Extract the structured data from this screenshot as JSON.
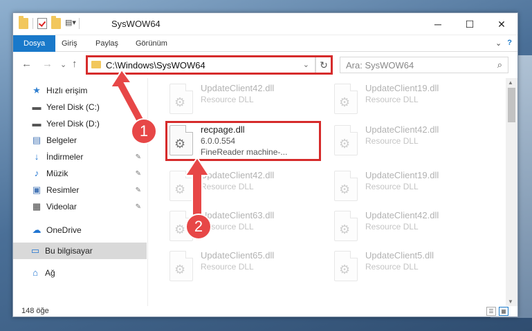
{
  "window": {
    "title": "SysWOW64",
    "minimize": "─",
    "maximize": "☐",
    "close": "✕"
  },
  "ribbon": {
    "tabs": [
      "Dosya",
      "Giriş",
      "Paylaş",
      "Görünüm"
    ],
    "expand": "⌄",
    "help": "?"
  },
  "nav": {
    "back": "←",
    "forward": "→",
    "recent": "⌄",
    "up": "↑",
    "address": "C:\\Windows\\SysWOW64",
    "address_dropdown": "⌄",
    "refresh": "↻",
    "search_placeholder": "Ara: SysWOW64",
    "search_icon": "⌕"
  },
  "sidebar": {
    "items": [
      {
        "label": "Hızlı erişim",
        "icon": "star-icon",
        "glyph": "★"
      },
      {
        "label": "Yerel Disk (C:)",
        "icon": "drive-icon",
        "glyph": "▬"
      },
      {
        "label": "Yerel Disk (D:)",
        "icon": "drive-icon",
        "glyph": "▬"
      },
      {
        "label": "Belgeler",
        "icon": "documents-icon",
        "glyph": "▤"
      },
      {
        "label": "İndirmeler",
        "icon": "download-icon",
        "glyph": "↓"
      },
      {
        "label": "Müzik",
        "icon": "music-icon",
        "glyph": "♪"
      },
      {
        "label": "Resimler",
        "icon": "pictures-icon",
        "glyph": "▣"
      },
      {
        "label": "Videolar",
        "icon": "videos-icon",
        "glyph": "▦"
      },
      {
        "label": "OneDrive",
        "icon": "cloud-icon",
        "glyph": "☁"
      },
      {
        "label": "Bu bilgisayar",
        "icon": "computer-icon",
        "glyph": "▭"
      },
      {
        "label": "Ağ",
        "icon": "network-icon",
        "glyph": "⌂"
      }
    ],
    "pin_glyph": "✎"
  },
  "files": {
    "left": [
      {
        "name": "UpdateClient42.dll",
        "type": "Resource DLL"
      },
      {
        "name": "recpage.dll",
        "type": "6.0.0.554",
        "desc": "FineReader machine-..."
      },
      {
        "name": "UpdateClient42.dll",
        "type": "Resource DLL"
      },
      {
        "name": "UpdateClient63.dll",
        "type": "Resource DLL"
      },
      {
        "name": "UpdateClient65.dll",
        "type": "Resource DLL"
      }
    ],
    "right": [
      {
        "name": "UpdateClient19.dll",
        "type": "Resource DLL"
      },
      {
        "name": "UpdateClient42.dll",
        "type": "Resource DLL"
      },
      {
        "name": "UpdateClient19.dll",
        "type": "Resource DLL"
      },
      {
        "name": "UpdateClient42.dll",
        "type": "Resource DLL"
      },
      {
        "name": "UpdateClient5.dll",
        "type": "Resource DLL"
      }
    ],
    "gear_glyph": "⚙"
  },
  "status": {
    "count": "148 öğe",
    "details_view": "☰",
    "icons_view": "▦"
  },
  "annotations": {
    "step1": "1",
    "step2": "2",
    "color": "#e74747"
  }
}
